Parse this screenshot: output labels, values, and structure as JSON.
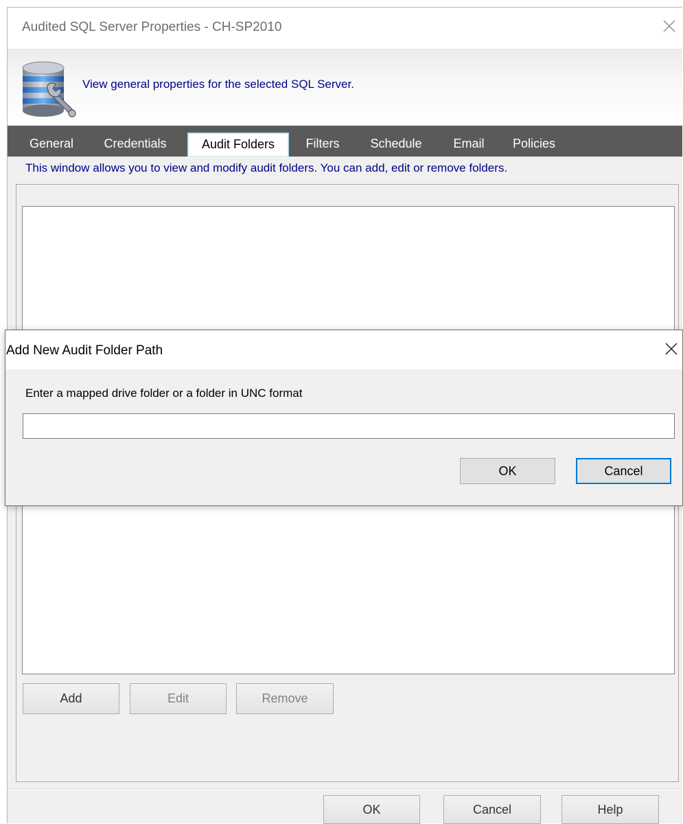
{
  "main_window": {
    "title": "Audited SQL Server Properties - CH-SP2010",
    "banner_text": "View general properties for the selected SQL Server.",
    "banner_icon": "sql-server-properties-icon",
    "tabs": [
      {
        "label": "General"
      },
      {
        "label": "Credentials"
      },
      {
        "label": "Audit Folders",
        "active": true
      },
      {
        "label": "Filters"
      },
      {
        "label": "Schedule"
      },
      {
        "label": "Email"
      },
      {
        "label": "Policies"
      }
    ],
    "tab_description": "This window allows you to view and modify audit folders.  You can add, edit or remove folders.",
    "folders": [],
    "list_buttons": {
      "add": "Add",
      "edit": "Edit",
      "remove": "Remove"
    },
    "footer_buttons": {
      "ok": "OK",
      "cancel": "Cancel",
      "help": "Help"
    }
  },
  "dialog": {
    "title": "Add New Audit Folder Path",
    "prompt": "Enter a mapped drive folder or a folder in UNC format",
    "input_value": "",
    "ok_label": "OK",
    "cancel_label": "Cancel"
  },
  "colors": {
    "description_text": "#00008b",
    "tab_strip": "#5a5a5a",
    "default_button_border": "#0078d7"
  }
}
